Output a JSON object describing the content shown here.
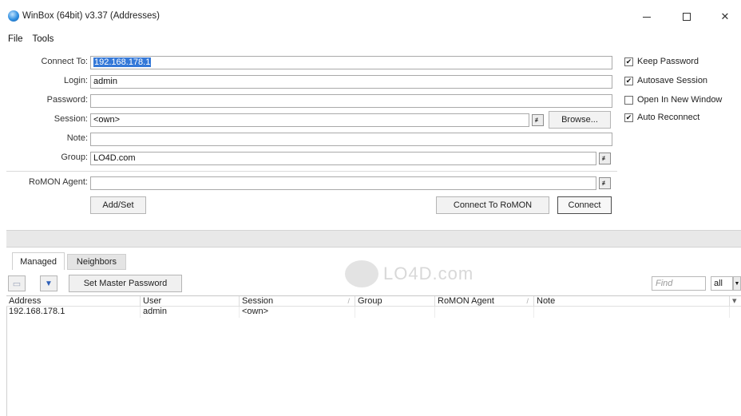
{
  "window": {
    "title": "WinBox (64bit) v3.37 (Addresses)",
    "minimize_glyph": "—",
    "close_glyph": "✕"
  },
  "menu": {
    "items": [
      "File",
      "Tools"
    ]
  },
  "form": {
    "connect_to_label": "Connect To:",
    "connect_to_value": "192.168.178.1",
    "login_label": "Login:",
    "login_value": "admin",
    "password_label": "Password:",
    "password_value": "",
    "session_label": "Session:",
    "session_value": "<own>",
    "browse_label": "Browse...",
    "note_label": "Note:",
    "note_value": "",
    "group_label": "Group:",
    "group_value": "LO4D.com",
    "romon_agent_label": "RoMON Agent:",
    "romon_agent_value": "",
    "dropdown_glyph": "≢",
    "add_set_label": "Add/Set",
    "connect_to_romon_label": "Connect To RoMON",
    "connect_label": "Connect"
  },
  "options": [
    {
      "label": "Keep Password",
      "checked": true
    },
    {
      "label": "Autosave Session",
      "checked": true
    },
    {
      "label": "Open In New Window",
      "checked": false
    },
    {
      "label": "Auto Reconnect",
      "checked": true
    }
  ],
  "check_glyph": "✔",
  "tabs": {
    "managed": "Managed",
    "neighbors": "Neighbors"
  },
  "toolbar": {
    "remove_glyph": "▭",
    "filter_glyph": "▼",
    "set_master_password": "Set Master Password",
    "find_placeholder": "Find",
    "all_value": "all",
    "all_dropdown_glyph": "▼"
  },
  "table": {
    "columns": [
      "Address",
      "User",
      "Session",
      "Group",
      "RoMON Agent",
      "Note"
    ],
    "rows": [
      {
        "address": "192.168.178.1",
        "user": "admin",
        "session": "<own>",
        "group": "",
        "romon_agent": "",
        "note": ""
      }
    ],
    "column_menu_glyph": "▾"
  },
  "watermark": {
    "text": "LO4D.com"
  }
}
